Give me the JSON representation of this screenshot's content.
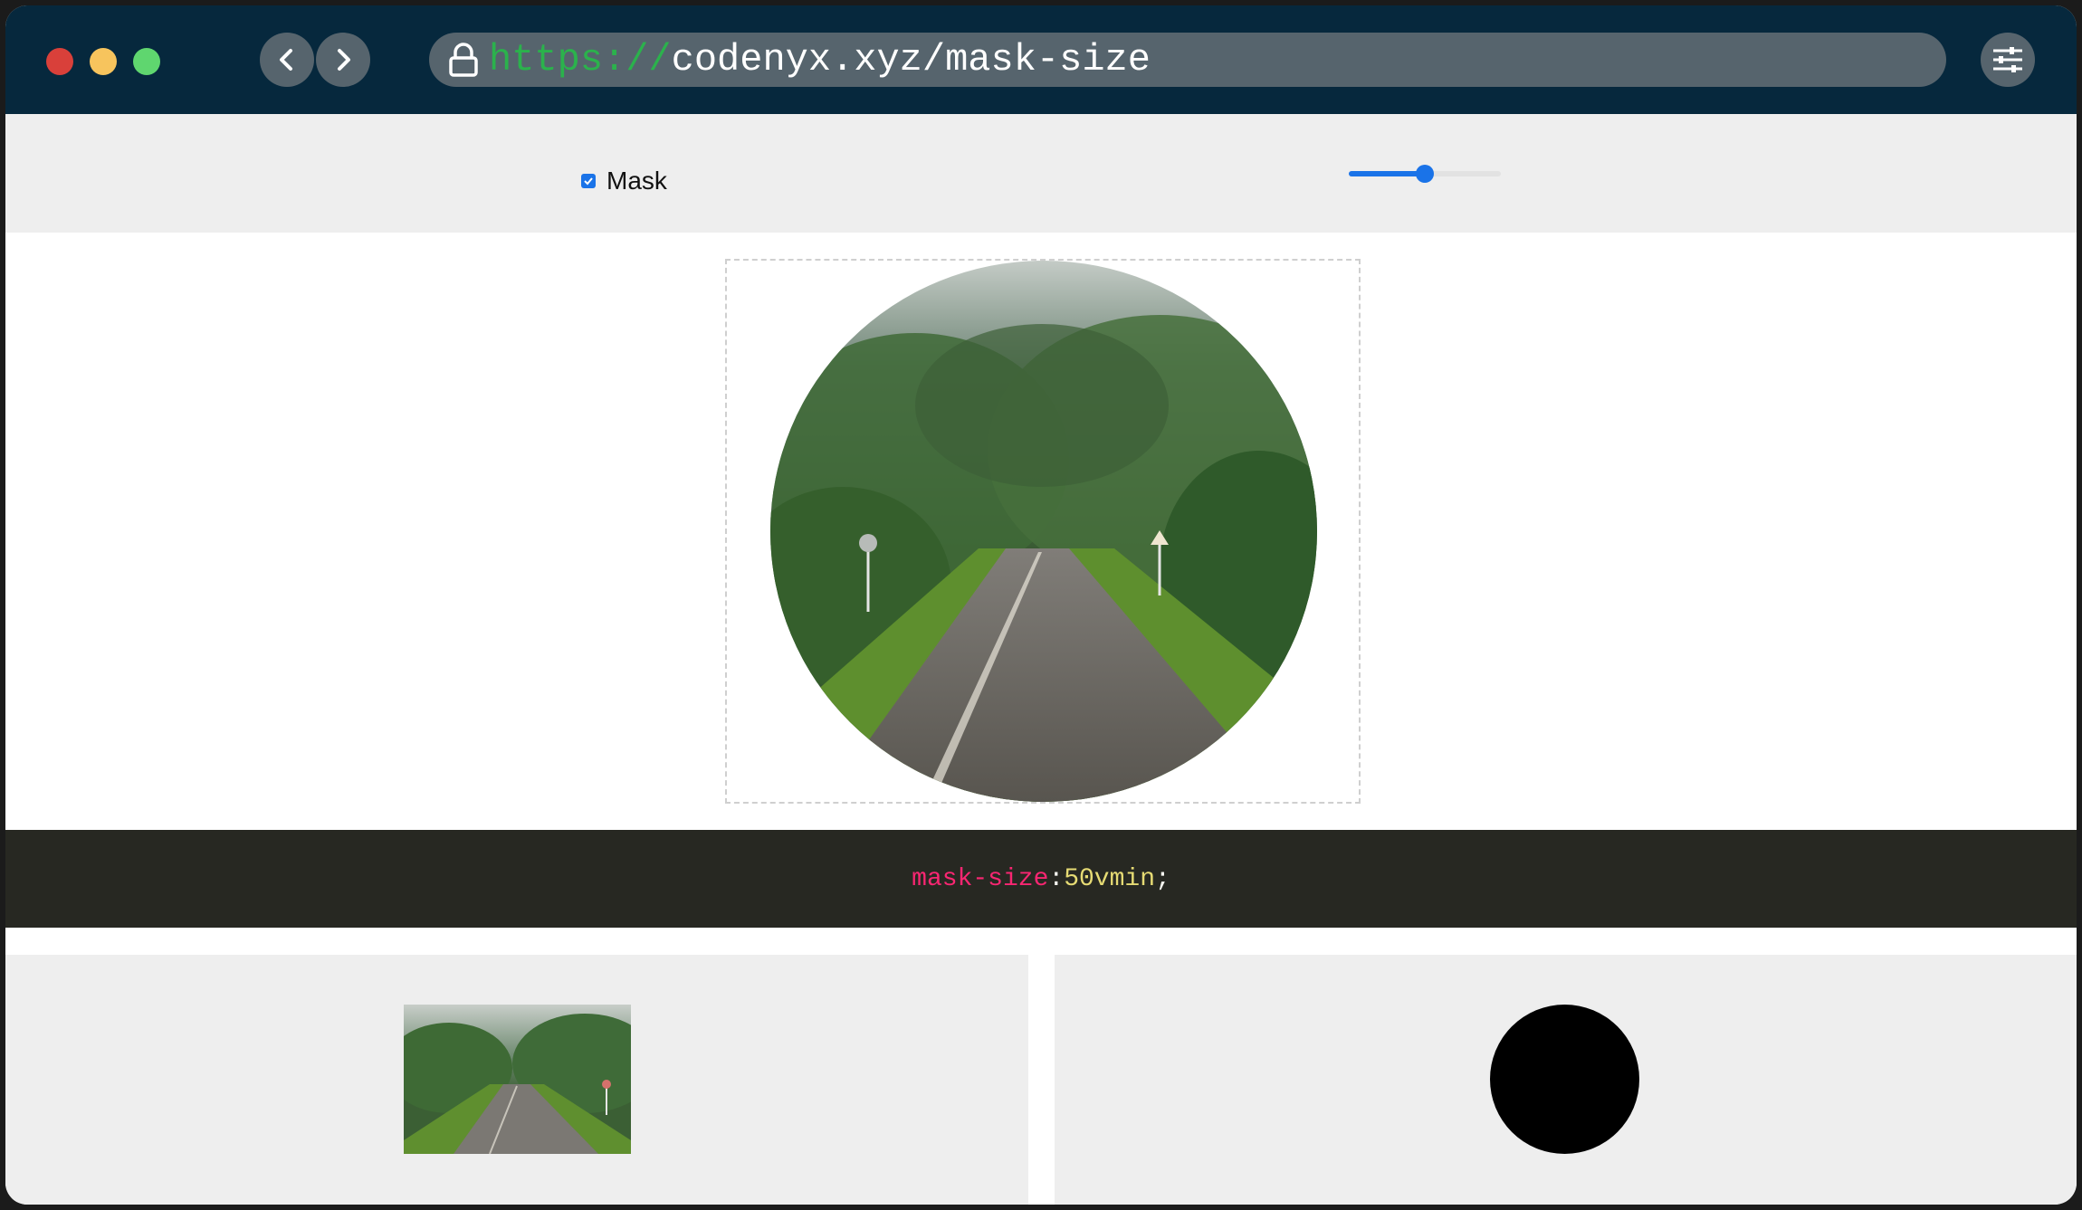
{
  "browser": {
    "url_protocol": "https://",
    "url_rest": "codenyx.xyz/mask-size",
    "back_icon": "chevron-left-icon",
    "forward_icon": "chevron-right-icon",
    "lock_icon": "lock-icon",
    "menu_icon": "sliders-icon"
  },
  "controls": {
    "mask_label": "Mask",
    "mask_checked": true,
    "slider_value_fraction": 0.5
  },
  "code": {
    "property": "mask-size",
    "colon": ": ",
    "value": "50vmin",
    "semicolon": ";"
  },
  "panels": {
    "left_content": "source-photo",
    "right_content": "circle-mask"
  },
  "colors": {
    "titlebar": "#06283d",
    "accent": "#1a73e8",
    "code_bg": "#272822",
    "code_property": "#f92672",
    "code_value": "#e6db74",
    "protocol": "#2bb24c"
  }
}
